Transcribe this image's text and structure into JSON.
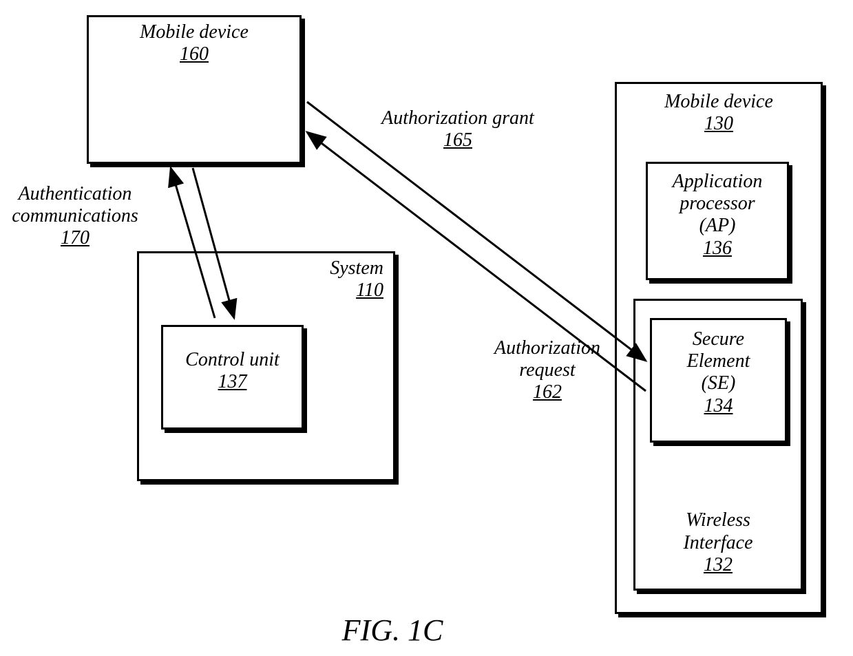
{
  "figure_caption": "FIG. 1C",
  "mobile_device_160": {
    "title": "Mobile device",
    "ref": "160"
  },
  "mobile_device_130": {
    "title": "Mobile device",
    "ref": "130"
  },
  "system": {
    "title": "System",
    "ref": "110"
  },
  "control_unit": {
    "title": "Control unit",
    "ref": "137"
  },
  "app_processor": {
    "line1": "Application",
    "line2": "processor",
    "line3": "(AP)",
    "ref": "136"
  },
  "secure_element": {
    "line1": "Secure",
    "line2": "Element",
    "line3": "(SE)",
    "ref": "134"
  },
  "wireless_if": {
    "line1": "Wireless",
    "line2": "Interface",
    "ref": "132"
  },
  "auth_comm": {
    "line1": "Authentication",
    "line2": "communications",
    "ref": "170"
  },
  "auth_grant": {
    "line1": "Authorization grant",
    "ref": "165"
  },
  "auth_req": {
    "line1": "Authorization",
    "line2": "request",
    "ref": "162"
  }
}
